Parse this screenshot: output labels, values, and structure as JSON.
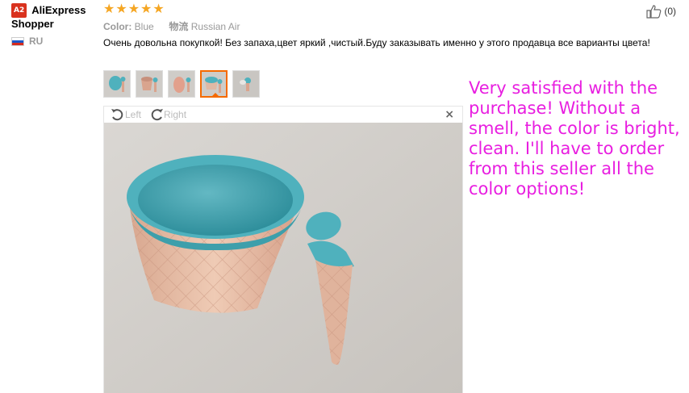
{
  "reviewer": {
    "badge": "A2",
    "name_first": "AliExpress",
    "name_second": "Shopper",
    "country": "RU"
  },
  "rating": {
    "stars": 5,
    "max": 5,
    "color": "#f5a623"
  },
  "meta": {
    "color_label": "Color:",
    "color_value": "Blue",
    "shipping_label": "物流",
    "shipping_value": "Russian Air"
  },
  "like": {
    "count": "(0)"
  },
  "review_text": "Очень довольна покупкой! Без запаха,цвет яркий ,чистый.Буду заказывать именно у этого продавца все варианты цвета!",
  "thumbnails": [
    {
      "name": "thumbnail-1",
      "active": false
    },
    {
      "name": "thumbnail-2",
      "active": false
    },
    {
      "name": "thumbnail-3",
      "active": false
    },
    {
      "name": "thumbnail-4",
      "active": true
    },
    {
      "name": "thumbnail-5",
      "active": false
    }
  ],
  "viewer": {
    "rotate_left": "Left",
    "rotate_right": "Right",
    "close": "×"
  },
  "translation": "Very satisfied with the purchase! Without a smell, the color is bright, clean. I'll have to order from this seller all the color options!",
  "colors": {
    "accent": "#f56a00",
    "translation": "#e81ee0",
    "bowl": "#4fb1bd"
  }
}
